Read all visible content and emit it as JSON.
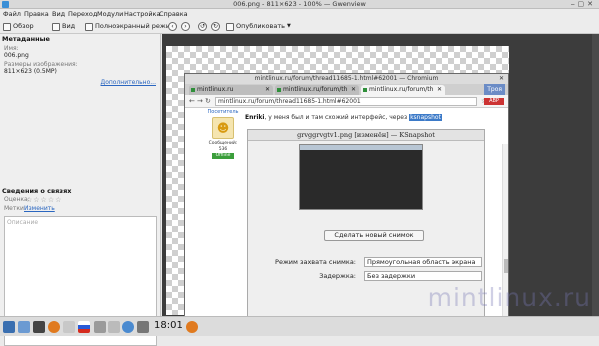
{
  "window": {
    "title": "006.png - 811×623 - 100% — Gwenview"
  },
  "menu": [
    "Файл",
    "Правка",
    "Вид",
    "Переход",
    "Модули",
    "Настройка",
    "Справка"
  ],
  "toolbar": {
    "browse": "Обзор",
    "view": "Вид",
    "fullscreen": "Полноэкранный режим",
    "share": "Опубликовать"
  },
  "sidebar": {
    "meta_header": "Метаданные",
    "name_label": "Имя:",
    "name_value": "006.png",
    "size_label": "Размеры изображения:",
    "size_value": "811×623 (0.5MP)",
    "more_link": "Дополнительно...",
    "links_header": "Сведения о связях",
    "rating_label": "Оценка:",
    "tags_label": "Метки:",
    "tags_link": "Изменить",
    "comment_placeholder": "Описание"
  },
  "browser": {
    "title": "mintlinux.ru/forum/thread11685-1.html#62001 — Chromium",
    "tabs": [
      "mintlinux.ru",
      "mintlinux.ru/forum/th",
      "mintlinux.ru/forum/th"
    ],
    "extra_tab": "Троя",
    "url": "mintlinux.ru/forum/thread11685-1.html#62001"
  },
  "post": {
    "role": "Посетитель",
    "messages_label": "Сообщений:",
    "messages_count": "536",
    "status": "Offline",
    "author": "Enriki",
    "text": ", у меня был и там схожий интерфейс, через ",
    "highlight": "ksnapshot"
  },
  "ksnapshot": {
    "title": "grvggrvgtv1.png [изменён] — KSnapshot",
    "new_button": "Сделать новый снимок",
    "mode_label": "Режим захвата снимка:",
    "mode_value": "Прямоугольная область экрана",
    "delay_label": "Задержка:",
    "delay_value": "Без задержки"
  },
  "watermark": "mintlinux.ru",
  "taskbar": {
    "time": "18:01"
  }
}
